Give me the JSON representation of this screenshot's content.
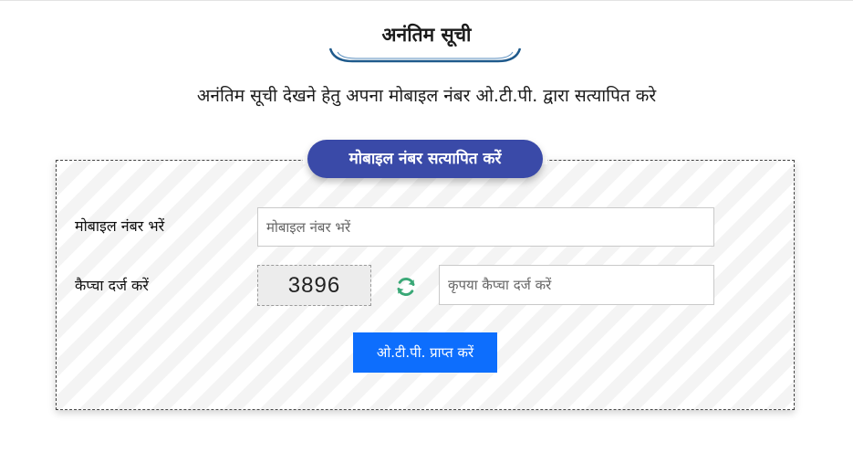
{
  "header": {
    "title": "अनंतिम सूची",
    "subtitle": "अनंतिम सूची देखने हेतु अपना मोबाइल नंबर ओ.टी.पी. द्वारा सत्यापित करे"
  },
  "form": {
    "legend": "मोबाइल नंबर सत्यापित करें",
    "mobile": {
      "label": "मोबाइल नंबर भरें",
      "value": "",
      "placeholder": "मोबाइल नंबर भरें"
    },
    "captcha": {
      "label": "कैप्चा दर्ज करें",
      "code": "3896",
      "refresh_icon": "refresh-icon",
      "value": "",
      "placeholder": "कृपया कैप्चा दर्ज करें"
    },
    "submit_label": "ओ.टी.पी. प्राप्त करें"
  },
  "colors": {
    "legend_bg": "#3a4aa8",
    "button_bg": "#0d6efd",
    "underline": "#1f5a8c",
    "refresh_icon": "#3aa877"
  }
}
